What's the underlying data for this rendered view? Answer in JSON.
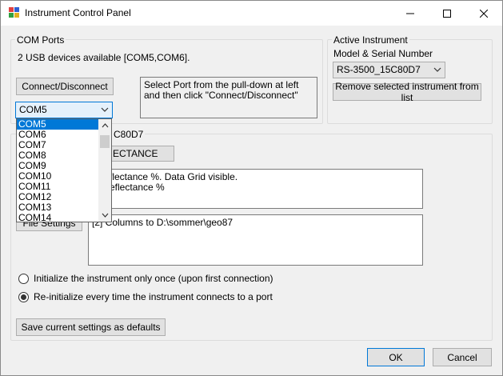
{
  "window": {
    "title": "Instrument Control Panel",
    "minimize": "minimize",
    "maximize": "maximize",
    "close": "close"
  },
  "com_ports": {
    "group_label": "COM Ports",
    "devices_text": "2 USB devices available [COM5,COM6].",
    "connect_button": "Connect/Disconnect",
    "instructions": "Select Port from the pull-down at left and then click \"Connect/Disconnect\"",
    "selected_port": "COM5",
    "dropdown_items": [
      "COM5",
      "COM6",
      "COM7",
      "COM8",
      "COM9",
      "COM10",
      "COM11",
      "COM12",
      "COM13",
      "COM14"
    ],
    "dropdown_selected_index": 0
  },
  "active_instrument": {
    "group_label": "Active Instrument",
    "model_label": "Model & Serial Number",
    "selected": "RS-3500_15C80D7",
    "remove_button": "Remove selected instrument from list"
  },
  "instrument_settings": {
    "group_label_visible": "C80D7",
    "mode_button": "ECTANCE",
    "mode_info_line1": ":  Reflectance %. Data Grid visible.",
    "mode_info_line2": "e: Reflectance %",
    "file_settings_button": "File Settings",
    "file_info": "[2] Columns to D:\\sommer\\geo87"
  },
  "init_options": {
    "once_label": "Initialize the instrument only once (upon first connection)",
    "every_label": "Re-initialize every time the instrument connects to a port",
    "selected": "every"
  },
  "save_defaults_button": "Save current settings as defaults",
  "ok_button": "OK",
  "cancel_button": "Cancel"
}
